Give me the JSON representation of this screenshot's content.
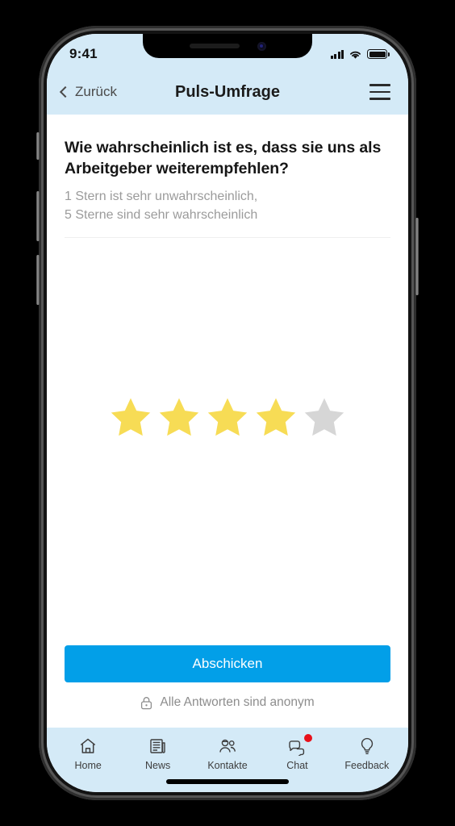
{
  "status_bar": {
    "time": "9:41",
    "signal_icon": "signal-bars-icon",
    "wifi_icon": "wifi-icon",
    "battery_icon": "battery-full-icon"
  },
  "nav_header": {
    "back_label": "Zurück",
    "back_icon": "chevron-left-icon",
    "title": "Puls-Umfrage",
    "menu_icon": "hamburger-menu-icon"
  },
  "survey": {
    "question": "Wie wahrscheinlich ist es, dass sie uns als Arbeitgeber weiterempfehlen?",
    "hint_line_1": "1 Stern ist sehr unwahrscheinlich,",
    "hint_line_2": "5 Sterne sind sehr wahrscheinlich",
    "rating": {
      "selected": 4,
      "total": 5,
      "filled_color": "#F7DC55",
      "empty_color": "#D6D6D6"
    }
  },
  "footer": {
    "submit_label": "Abschicken",
    "submit_color": "#029FE8",
    "anonymous_note": "Alle Antworten sind anonym",
    "lock_icon": "lock-icon"
  },
  "tab_bar": {
    "items": [
      {
        "label": "Home",
        "icon": "home-icon",
        "badge": false
      },
      {
        "label": "News",
        "icon": "news-icon",
        "badge": false
      },
      {
        "label": "Kontakte",
        "icon": "contacts-icon",
        "badge": false
      },
      {
        "label": "Chat",
        "icon": "chat-icon",
        "badge": true
      },
      {
        "label": "Feedback",
        "icon": "lightbulb-icon",
        "badge": false
      }
    ],
    "badge_color": "#E8111A"
  }
}
